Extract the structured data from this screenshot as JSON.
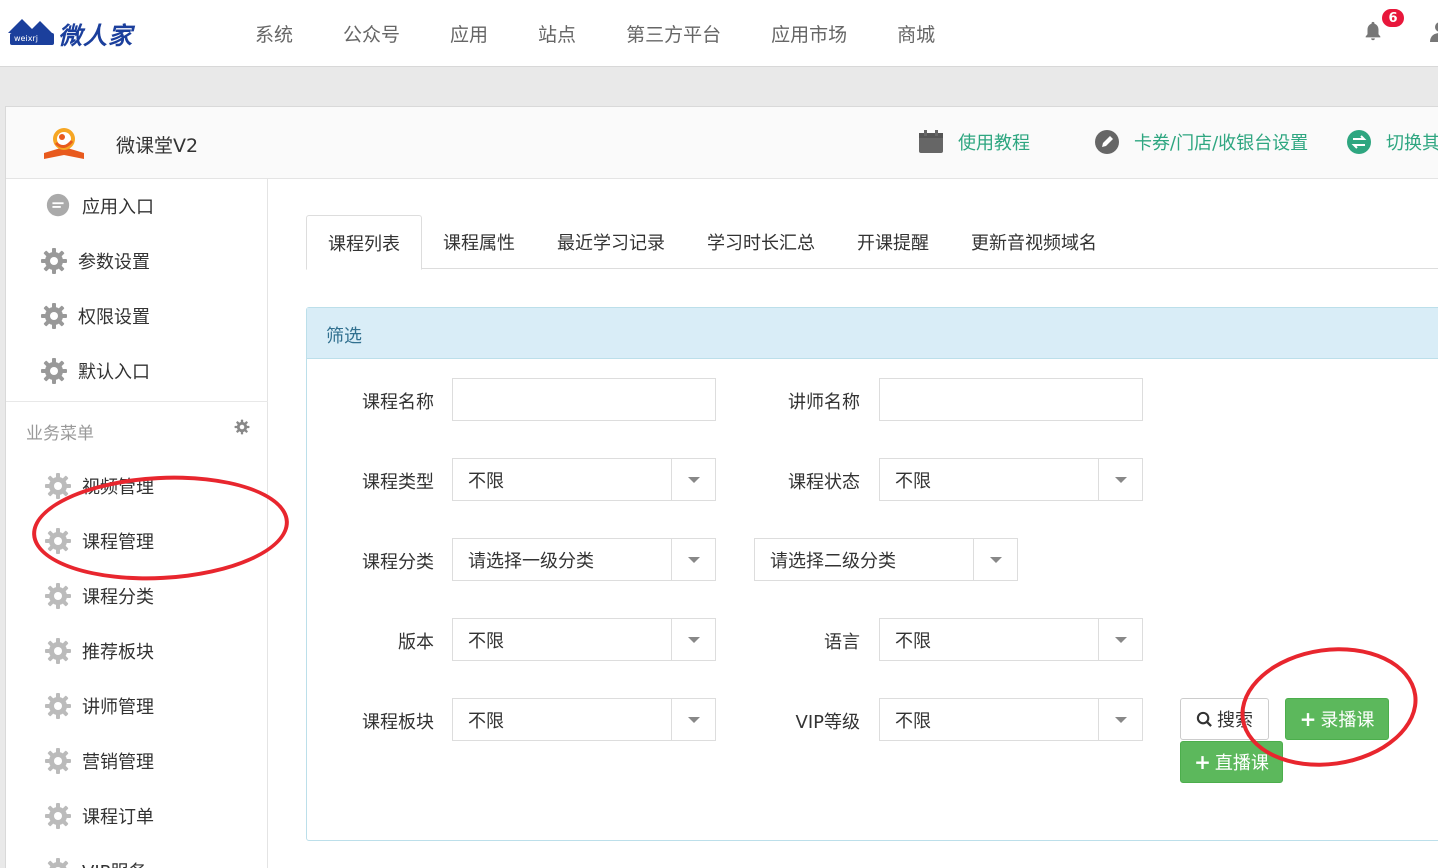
{
  "brand": {
    "logo_sub": "weixrj",
    "logo_text": "微人家"
  },
  "nav": {
    "items": [
      "系统",
      "公众号",
      "应用",
      "站点",
      "第三方平台",
      "应用市场",
      "商城"
    ]
  },
  "notifications": {
    "count": "6"
  },
  "app": {
    "name": "微课堂V2",
    "links": [
      {
        "label": "使用教程",
        "icon": "calendar-icon"
      },
      {
        "label": "卡券/门店/收银台设置",
        "icon": "pencil-icon"
      },
      {
        "label": "切换其",
        "icon": "switch-icon"
      }
    ]
  },
  "sidebar": {
    "top_items": [
      {
        "label": "应用入口",
        "icon": "chat-icon"
      },
      {
        "label": "参数设置",
        "icon": "gear-icon"
      },
      {
        "label": "权限设置",
        "icon": "gear-icon"
      },
      {
        "label": "默认入口",
        "icon": "gear-icon"
      }
    ],
    "section_title": "业务菜单",
    "business_items": [
      {
        "label": "视频管理"
      },
      {
        "label": "课程管理"
      },
      {
        "label": "课程分类"
      },
      {
        "label": "推荐板块"
      },
      {
        "label": "讲师管理"
      },
      {
        "label": "营销管理"
      },
      {
        "label": "课程订单"
      },
      {
        "label": "VIP服务"
      }
    ]
  },
  "tabs": [
    "课程列表",
    "课程属性",
    "最近学习记录",
    "学习时长汇总",
    "开课提醒",
    "更新音视频域名"
  ],
  "filter": {
    "title": "筛选",
    "course_name": {
      "label": "课程名称",
      "value": ""
    },
    "teacher_name": {
      "label": "讲师名称",
      "value": ""
    },
    "course_type": {
      "label": "课程类型",
      "value": "不限"
    },
    "course_status": {
      "label": "课程状态",
      "value": "不限"
    },
    "category": {
      "label": "课程分类",
      "level1": "请选择一级分类",
      "level2": "请选择二级分类"
    },
    "version": {
      "label": "版本",
      "value": "不限"
    },
    "language": {
      "label": "语言",
      "value": "不限"
    },
    "block": {
      "label": "课程板块",
      "value": "不限"
    },
    "vip_level": {
      "label": "VIP等级",
      "value": "不限"
    },
    "buttons": {
      "search": "搜索",
      "recorded": "录播课",
      "live": "直播课"
    }
  },
  "colors": {
    "accent_green": "#5cb85c",
    "link_green": "#2ea680",
    "annotation_red": "#e8262e",
    "badge_red": "#e8173b",
    "brand_blue": "#1b3f9c"
  }
}
